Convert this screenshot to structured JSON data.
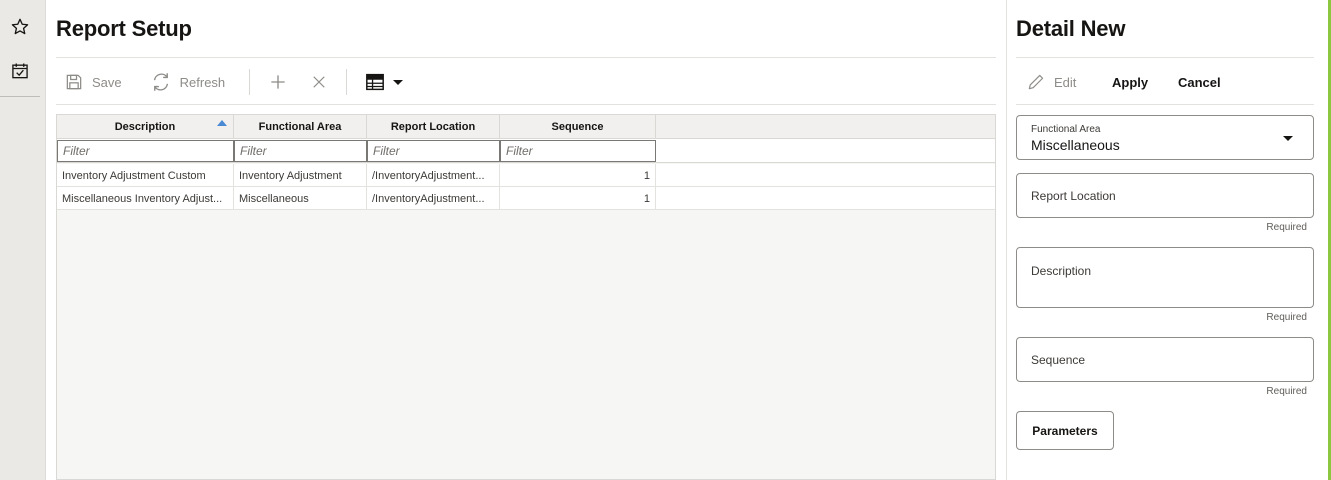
{
  "rail": {
    "favorites_icon": "star-outline-icon",
    "tasks_icon": "calendar-check-icon"
  },
  "page": {
    "title": "Report Setup"
  },
  "toolbar": {
    "save_label": "Save",
    "refresh_label": "Refresh",
    "add_icon": "plus-icon",
    "delete_icon": "close-icon",
    "view_icon": "table-grid-icon"
  },
  "grid": {
    "columns": [
      {
        "label": "Description",
        "sorted": "ascending"
      },
      {
        "label": "Functional Area"
      },
      {
        "label": "Report Location"
      },
      {
        "label": "Sequence"
      }
    ],
    "filter_placeholder": "Filter",
    "rows": [
      {
        "description": "Inventory Adjustment Custom",
        "functional_area": "Inventory Adjustment",
        "report_location": "/InventoryAdjustment...",
        "sequence": "1"
      },
      {
        "description": "Miscellaneous Inventory Adjust...",
        "functional_area": "Miscellaneous",
        "report_location": "/InventoryAdjustment...",
        "sequence": "1"
      }
    ]
  },
  "detail": {
    "title": "Detail New",
    "edit_label": "Edit",
    "apply_label": "Apply",
    "cancel_label": "Cancel",
    "functional_area_label": "Functional Area",
    "functional_area_value": "Miscellaneous",
    "report_location_label": "Report Location",
    "description_label": "Description",
    "sequence_label": "Sequence",
    "required_text": "Required",
    "parameters_label": "Parameters"
  },
  "colors": {
    "accent": "#8dc63f",
    "sort_indicator": "#4a8ad4",
    "rail_background": "#eae9e6"
  }
}
